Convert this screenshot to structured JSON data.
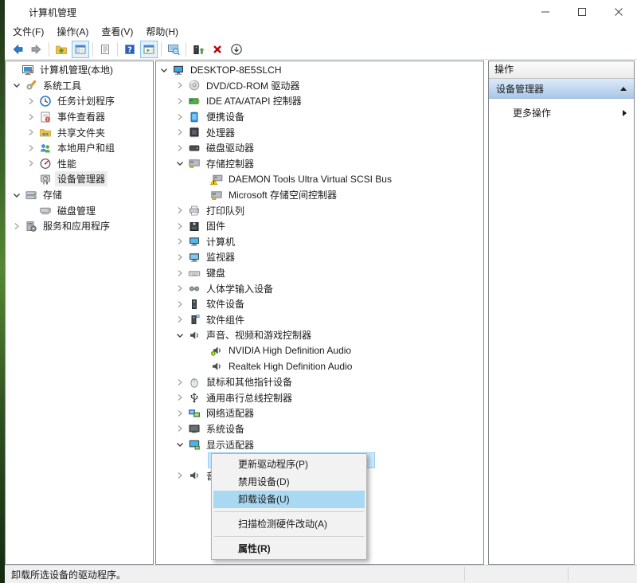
{
  "window": {
    "title": "计算机管理"
  },
  "menu_bar": [
    "文件(F)",
    "操作(A)",
    "查看(V)",
    "帮助(H)"
  ],
  "toolbar": [
    {
      "type": "button",
      "name": "back",
      "icon": "arrow-left"
    },
    {
      "type": "button",
      "name": "forward",
      "icon": "arrow-right"
    },
    {
      "type": "separator"
    },
    {
      "type": "button",
      "name": "up-one-level",
      "icon": "folder-up"
    },
    {
      "type": "button",
      "name": "show-console-tree",
      "icon": "console-window",
      "pressed": true
    },
    {
      "type": "separator"
    },
    {
      "type": "button",
      "name": "properties-list",
      "icon": "document"
    },
    {
      "type": "separator"
    },
    {
      "type": "button",
      "name": "help",
      "icon": "help"
    },
    {
      "type": "button",
      "name": "show-action-pane",
      "icon": "action-window",
      "pressed": true
    },
    {
      "type": "separator"
    },
    {
      "type": "button",
      "name": "scan-hardware-changes",
      "icon": "monitor-search"
    },
    {
      "type": "separator"
    },
    {
      "type": "button",
      "name": "update-driver",
      "icon": "device-up"
    },
    {
      "type": "button",
      "name": "uninstall",
      "icon": "red-x"
    },
    {
      "type": "button",
      "name": "disable",
      "icon": "circle-down"
    }
  ],
  "left_tree": [
    {
      "level": 0,
      "expander": "none",
      "icon": "computer-management",
      "label": "计算机管理(本地)"
    },
    {
      "level": 1,
      "expander": "expanded",
      "icon": "system-tools",
      "label": "系统工具"
    },
    {
      "level": 2,
      "expander": "collapsed",
      "icon": "task-scheduler",
      "label": "任务计划程序"
    },
    {
      "level": 2,
      "expander": "collapsed",
      "icon": "event-viewer",
      "label": "事件查看器"
    },
    {
      "level": 2,
      "expander": "collapsed",
      "icon": "shared-folders",
      "label": "共享文件夹"
    },
    {
      "level": 2,
      "expander": "collapsed",
      "icon": "local-users",
      "label": "本地用户和组"
    },
    {
      "level": 2,
      "expander": "collapsed",
      "icon": "performance",
      "label": "性能"
    },
    {
      "level": 2,
      "expander": "none",
      "icon": "device-manager",
      "label": "设备管理器",
      "selected": "gray"
    },
    {
      "level": 1,
      "expander": "expanded",
      "icon": "storage",
      "label": "存储"
    },
    {
      "level": 2,
      "expander": "none",
      "icon": "disk-management",
      "label": "磁盘管理"
    },
    {
      "level": 1,
      "expander": "collapsed",
      "icon": "services",
      "label": "服务和应用程序"
    }
  ],
  "device_tree": [
    {
      "level": 0,
      "expander": "expanded",
      "icon": "computer",
      "label": "DESKTOP-8E5SLCH"
    },
    {
      "level": 1,
      "expander": "collapsed",
      "icon": "dvd-drive",
      "label": "DVD/CD-ROM 驱动器"
    },
    {
      "level": 1,
      "expander": "collapsed",
      "icon": "ide-controller",
      "label": "IDE ATA/ATAPI 控制器"
    },
    {
      "level": 1,
      "expander": "collapsed",
      "icon": "portable-device",
      "label": "便携设备"
    },
    {
      "level": 1,
      "expander": "collapsed",
      "icon": "processor",
      "label": "处理器"
    },
    {
      "level": 1,
      "expander": "collapsed",
      "icon": "disk-drive",
      "label": "磁盘驱动器"
    },
    {
      "level": 1,
      "expander": "expanded",
      "icon": "storage-controller",
      "label": "存储控制器"
    },
    {
      "level": 2,
      "expander": "none",
      "icon": "storage-controller-warning",
      "label": "DAEMON Tools Ultra Virtual SCSI Bus"
    },
    {
      "level": 2,
      "expander": "none",
      "icon": "storage-controller",
      "label": "Microsoft 存储空间控制器"
    },
    {
      "level": 1,
      "expander": "collapsed",
      "icon": "print-queue",
      "label": "打印队列"
    },
    {
      "level": 1,
      "expander": "collapsed",
      "icon": "firmware",
      "label": "固件"
    },
    {
      "level": 1,
      "expander": "collapsed",
      "icon": "computer-monitor",
      "label": "计算机"
    },
    {
      "level": 1,
      "expander": "collapsed",
      "icon": "monitor",
      "label": "监视器"
    },
    {
      "level": 1,
      "expander": "collapsed",
      "icon": "keyboard",
      "label": "键盘"
    },
    {
      "level": 1,
      "expander": "collapsed",
      "icon": "hid",
      "label": "人体学输入设备"
    },
    {
      "level": 1,
      "expander": "collapsed",
      "icon": "software-device",
      "label": "软件设备"
    },
    {
      "level": 1,
      "expander": "collapsed",
      "icon": "software-component",
      "label": "软件组件"
    },
    {
      "level": 1,
      "expander": "expanded",
      "icon": "audio-controller",
      "label": "声音、视频和游戏控制器"
    },
    {
      "level": 2,
      "expander": "none",
      "icon": "audio-nvidia",
      "label": "NVIDIA High Definition Audio"
    },
    {
      "level": 2,
      "expander": "none",
      "icon": "audio-realtek",
      "label": "Realtek High Definition Audio"
    },
    {
      "level": 1,
      "expander": "collapsed",
      "icon": "mouse",
      "label": "鼠标和其他指针设备"
    },
    {
      "level": 1,
      "expander": "collapsed",
      "icon": "usb-controller",
      "label": "通用串行总线控制器"
    },
    {
      "level": 1,
      "expander": "collapsed",
      "icon": "network-adapter",
      "label": "网络适配器"
    },
    {
      "level": 1,
      "expander": "collapsed",
      "icon": "system-device",
      "label": "系统设备"
    },
    {
      "level": 1,
      "expander": "expanded",
      "icon": "display-adapter",
      "label": "显示适配器"
    },
    {
      "level": 2,
      "expander": "none",
      "icon": "display-adapter",
      "label": "",
      "selected": "blue"
    },
    {
      "level": 1,
      "expander": "collapsed",
      "icon": "audio-io",
      "label": "音"
    }
  ],
  "context_menu": [
    {
      "label": "更新驱动程序(P)"
    },
    {
      "label": "禁用设备(D)"
    },
    {
      "label": "卸载设备(U)",
      "highlighted": true
    },
    {
      "type": "separator"
    },
    {
      "label": "扫描检测硬件改动(A)"
    },
    {
      "type": "separator"
    },
    {
      "label": "属性(R)",
      "bold": true
    }
  ],
  "action_pane": {
    "header": "操作",
    "section_title": "设备管理器",
    "more_actions": "更多操作"
  },
  "status_bar": {
    "text": "卸载所选设备的驱动程序。"
  },
  "colors": {
    "selection_blue": "#cce8ff",
    "selection_gray": "#ececec",
    "menu_highlight": "#a9d9f2",
    "action_header_gradient_top": "#dcebfa",
    "action_header_gradient_bottom": "#a9c7e8"
  }
}
